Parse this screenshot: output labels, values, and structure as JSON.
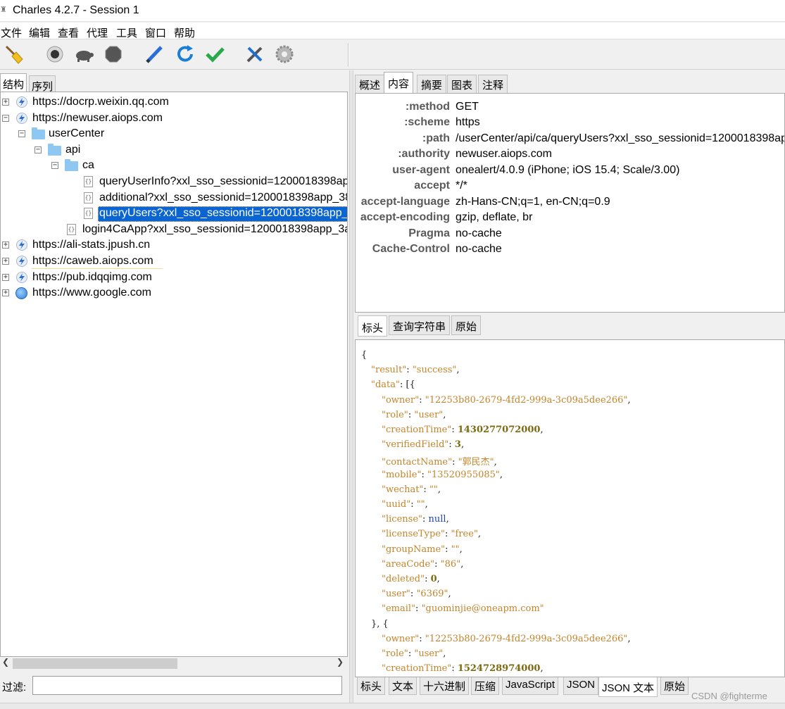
{
  "window": {
    "title": "Charles 4.2.7 - Session 1"
  },
  "menu": [
    "文件",
    "编辑",
    "查看",
    "代理",
    "工具",
    "窗口",
    "帮助"
  ],
  "toolbar": {
    "icons": [
      "broom-icon",
      "record-icon",
      "turtle-icon",
      "stop-icon",
      "pen-icon",
      "refresh-icon",
      "check-icon",
      "tools-icon",
      "gear-icon"
    ],
    "colors": {
      "refresh": "#1a7fd4",
      "check": "#2aa84a",
      "pen": "#2a6fd8"
    }
  },
  "left_tabs": {
    "structure": "结构",
    "sequence": "序列"
  },
  "tree": {
    "hosts": [
      {
        "label": "https://docrp.weixin.qq.com"
      },
      {
        "label": "https://newuser.aiops.com"
      },
      {
        "label": "https://ali-stats.jpush.cn"
      },
      {
        "label": "https://caweb.aiops.com"
      },
      {
        "label": "https://pub.idqqimg.com"
      },
      {
        "label": "https://www.google.com"
      }
    ],
    "folders": {
      "usercenter": "userCenter",
      "api": "api",
      "ca": "ca"
    },
    "files": [
      "queryUserInfo?xxl_sso_sessionid=1200018398ap",
      "additional?xxl_sso_sessionid=1200018398app_38",
      "queryUsers?xxl_sso_sessionid=1200018398app_3",
      "login4CaApp?xxl_sso_sessionid=1200018398app_3a"
    ],
    "selection_color": "#0a64d2"
  },
  "filter": {
    "label": "过滤:",
    "value": ""
  },
  "right_tabs": [
    "概述",
    "内容",
    "摘要",
    "图表",
    "注释"
  ],
  "request_headers": [
    {
      "key": ":method",
      "value": "GET"
    },
    {
      "key": ":scheme",
      "value": "https"
    },
    {
      "key": ":path",
      "value": "/userCenter/api/ca/queryUsers?xxl_sso_sessionid=1200018398ap"
    },
    {
      "key": ":authority",
      "value": "newuser.aiops.com"
    },
    {
      "key": "user-agent",
      "value": "onealert/4.0.9 (iPhone; iOS 15.4; Scale/3.00)"
    },
    {
      "key": "accept",
      "value": "*/*"
    },
    {
      "key": "accept-language",
      "value": "zh-Hans-CN;q=1, en-CN;q=0.9"
    },
    {
      "key": "accept-encoding",
      "value": "gzip, deflate, br"
    },
    {
      "key": "Pragma",
      "value": "no-cache"
    },
    {
      "key": "Cache-Control",
      "value": "no-cache"
    }
  ],
  "mid_tabs": [
    "标头",
    "查询字符串",
    "原始"
  ],
  "json_lines": [
    [
      [
        "p",
        "{"
      ]
    ],
    [
      [
        "k",
        "\"result\""
      ],
      [
        "p",
        ": "
      ],
      [
        "s",
        "\"success\""
      ],
      [
        "p",
        ","
      ]
    ],
    [
      [
        "k",
        "\"data\""
      ],
      [
        "p",
        ": [{"
      ]
    ],
    [
      [
        "k",
        "\"owner\""
      ],
      [
        "p",
        ": "
      ],
      [
        "s",
        "\"12253b80-2679-4fd2-999a-3c09a5dee266\""
      ],
      [
        "p",
        ","
      ]
    ],
    [
      [
        "k",
        "\"role\""
      ],
      [
        "p",
        ": "
      ],
      [
        "s",
        "\"user\""
      ],
      [
        "p",
        ","
      ]
    ],
    [
      [
        "k",
        "\"creationTime\""
      ],
      [
        "p",
        ": "
      ],
      [
        "n",
        "1430277072000"
      ],
      [
        "p",
        ","
      ]
    ],
    [
      [
        "k",
        "\"verifiedField\""
      ],
      [
        "p",
        ": "
      ],
      [
        "n",
        "3"
      ],
      [
        "p",
        ","
      ]
    ],
    [
      [
        "k",
        "\"contactName\""
      ],
      [
        "p",
        ": "
      ],
      [
        "s",
        "\"郭民杰\""
      ],
      [
        "p",
        ","
      ]
    ],
    [
      [
        "k",
        "\"mobile\""
      ],
      [
        "p",
        ": "
      ],
      [
        "s",
        "\"13520955085\""
      ],
      [
        "p",
        ","
      ]
    ],
    [
      [
        "k",
        "\"wechat\""
      ],
      [
        "p",
        ": "
      ],
      [
        "s",
        "\"\""
      ],
      [
        "p",
        ","
      ]
    ],
    [
      [
        "k",
        "\"uuid\""
      ],
      [
        "p",
        ": "
      ],
      [
        "s",
        "\"\""
      ],
      [
        "p",
        ","
      ]
    ],
    [
      [
        "k",
        "\"license\""
      ],
      [
        "p",
        ": "
      ],
      [
        "u",
        "null"
      ],
      [
        "p",
        ","
      ]
    ],
    [
      [
        "k",
        "\"licenseType\""
      ],
      [
        "p",
        ": "
      ],
      [
        "s",
        "\"free\""
      ],
      [
        "p",
        ","
      ]
    ],
    [
      [
        "k",
        "\"groupName\""
      ],
      [
        "p",
        ": "
      ],
      [
        "s",
        "\"\""
      ],
      [
        "p",
        ","
      ]
    ],
    [
      [
        "k",
        "\"areaCode\""
      ],
      [
        "p",
        ": "
      ],
      [
        "s",
        "\"86\""
      ],
      [
        "p",
        ","
      ]
    ],
    [
      [
        "k",
        "\"deleted\""
      ],
      [
        "p",
        ": "
      ],
      [
        "n",
        "0"
      ],
      [
        "p",
        ","
      ]
    ],
    [
      [
        "k",
        "\"user\""
      ],
      [
        "p",
        ": "
      ],
      [
        "s",
        "\"6369\""
      ],
      [
        "p",
        ","
      ]
    ],
    [
      [
        "k",
        "\"email\""
      ],
      [
        "p",
        ": "
      ],
      [
        "s",
        "\"guominjie@oneapm.com\""
      ]
    ],
    [
      [
        "p",
        "}, {"
      ]
    ],
    [
      [
        "k",
        "\"owner\""
      ],
      [
        "p",
        ": "
      ],
      [
        "s",
        "\"12253b80-2679-4fd2-999a-3c09a5dee266\""
      ],
      [
        "p",
        ","
      ]
    ],
    [
      [
        "k",
        "\"role\""
      ],
      [
        "p",
        ": "
      ],
      [
        "s",
        "\"user\""
      ],
      [
        "p",
        ","
      ]
    ],
    [
      [
        "k",
        "\"creationTime\""
      ],
      [
        "p",
        ": "
      ],
      [
        "n",
        "1524728974000"
      ],
      [
        "p",
        ","
      ]
    ]
  ],
  "bottom_tabs": [
    "标头",
    "文本",
    "十六进制",
    "压缩",
    "JavaScript",
    "JSON",
    "JSON 文本",
    "原始"
  ],
  "watermark": "CSDN @fighterme"
}
